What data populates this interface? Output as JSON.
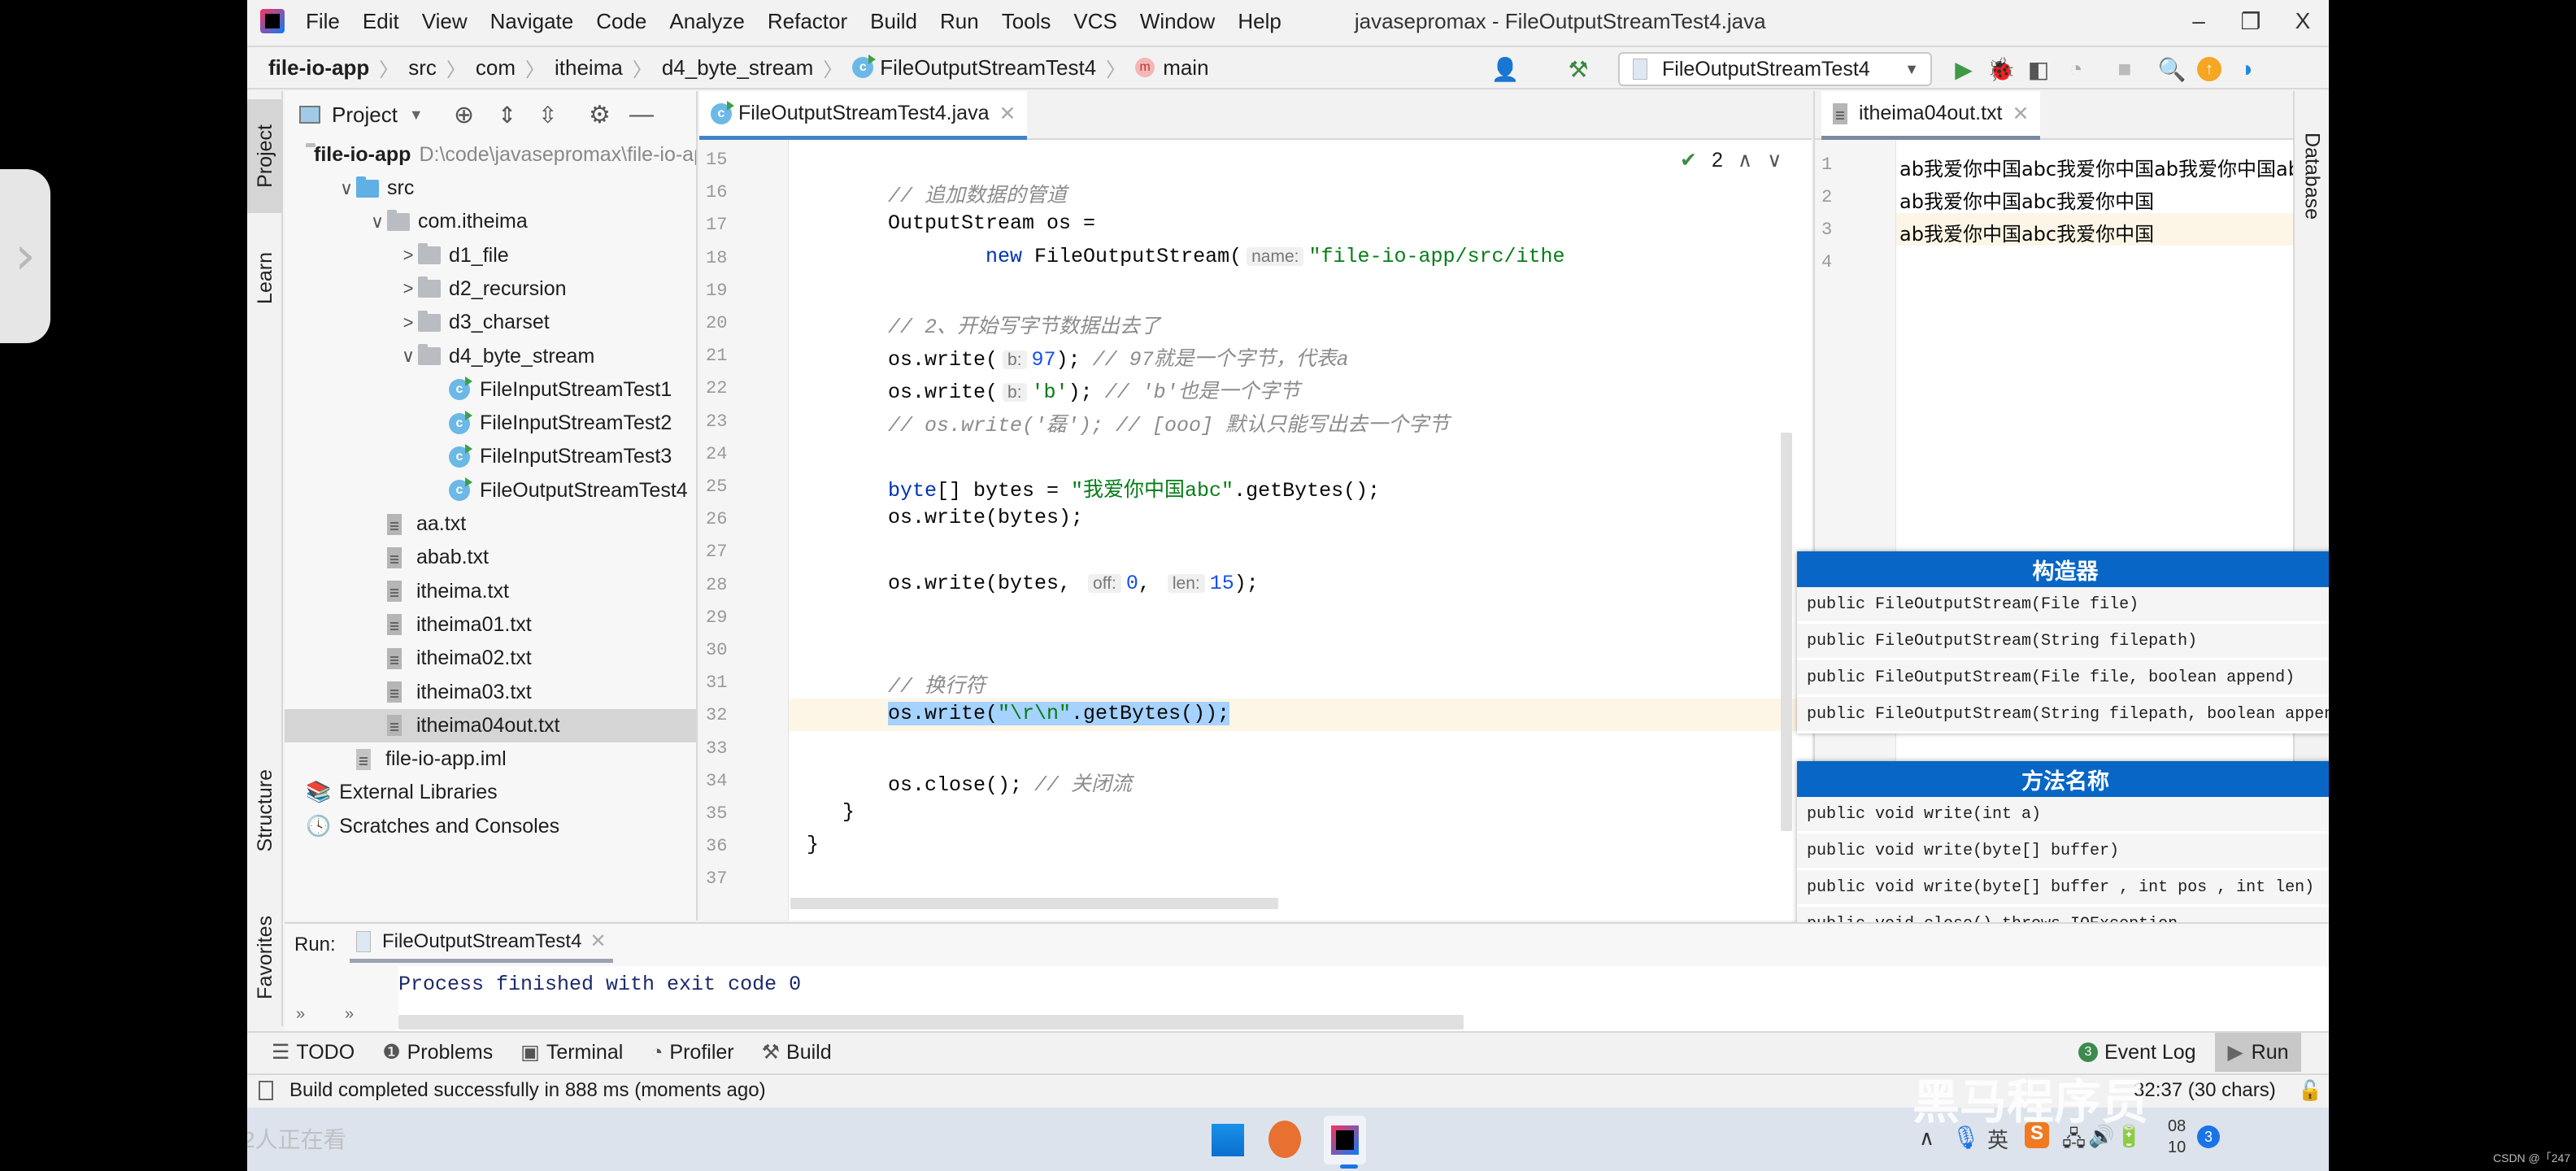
{
  "menu": {
    "items": [
      "File",
      "Edit",
      "View",
      "Navigate",
      "Code",
      "Analyze",
      "Refactor",
      "Build",
      "Run",
      "Tools",
      "VCS",
      "Window",
      "Help"
    ],
    "window_title": "javasepromax - FileOutputStreamTest4.java"
  },
  "window_controls": {
    "minimize": "–",
    "maximize": "❐",
    "close": "X"
  },
  "breadcrumb": [
    "file-io-app",
    "src",
    "com",
    "itheima",
    "d4_byte_stream",
    "FileOutputStreamTest4",
    "main"
  ],
  "toolbar": {
    "run_config": "FileOutputStreamTest4"
  },
  "left_stripe": {
    "project": "Project",
    "learn": "Learn",
    "structure": "Structure",
    "favorites": "Favorites"
  },
  "right_stripe": {
    "database": "Database"
  },
  "project": {
    "header": "Project",
    "root_name": "file-io-app",
    "root_path": "D:\\code\\javasepromax\\file-io-app",
    "tree": [
      {
        "label": "src",
        "type": "folder-blue",
        "depth": 1,
        "chevron": "∨"
      },
      {
        "label": "com.itheima",
        "type": "package",
        "depth": 2,
        "chevron": "∨"
      },
      {
        "label": "d1_file",
        "type": "package",
        "depth": 3,
        "chevron": ">"
      },
      {
        "label": "d2_recursion",
        "type": "package",
        "depth": 3,
        "chevron": ">"
      },
      {
        "label": "d3_charset",
        "type": "package",
        "depth": 3,
        "chevron": ">"
      },
      {
        "label": "d4_byte_stream",
        "type": "package",
        "depth": 3,
        "chevron": "∨"
      },
      {
        "label": "FileInputStreamTest1",
        "type": "class",
        "depth": 4
      },
      {
        "label": "FileInputStreamTest2",
        "type": "class",
        "depth": 4
      },
      {
        "label": "FileInputStreamTest3",
        "type": "class",
        "depth": 4
      },
      {
        "label": "FileOutputStreamTest4",
        "type": "class",
        "depth": 4
      },
      {
        "label": "aa.txt",
        "type": "txt",
        "depth": 2
      },
      {
        "label": "abab.txt",
        "type": "txt",
        "depth": 2
      },
      {
        "label": "itheima.txt",
        "type": "txt",
        "depth": 2
      },
      {
        "label": "itheima01.txt",
        "type": "txt",
        "depth": 2
      },
      {
        "label": "itheima02.txt",
        "type": "txt",
        "depth": 2
      },
      {
        "label": "itheima03.txt",
        "type": "txt",
        "depth": 2
      },
      {
        "label": "itheima04out.txt",
        "type": "txt",
        "depth": 2,
        "selected": true
      },
      {
        "label": "file-io-app.iml",
        "type": "iml",
        "depth": 1
      },
      {
        "label": "External Libraries",
        "type": "lib",
        "depth": 0
      },
      {
        "label": "Scratches and Consoles",
        "type": "scratch",
        "depth": 0
      }
    ]
  },
  "editor": {
    "tab": "FileOutputStreamTest4.java",
    "inspection_count": "2",
    "lines": [
      {
        "n": "15",
        "html": ""
      },
      {
        "n": "16",
        "html": "<span class='cm'>// 追加数据的管道</span>"
      },
      {
        "n": "17",
        "html": "OutputStream os ="
      },
      {
        "n": "18",
        "html": "        <span class='kw'>new</span> FileOutputStream(<span class='hint'>name:</span><span class='str'>\"file-io-app/src/ithe</span>"
      },
      {
        "n": "19",
        "html": ""
      },
      {
        "n": "20",
        "html": "<span class='cm'>// 2、开始写字节数据出去了</span>"
      },
      {
        "n": "21",
        "html": "os.write(<span class='hint'>b:</span><span class='num'>97</span>); <span class='cm'>// 97就是一个字节，代表a</span>"
      },
      {
        "n": "22",
        "html": "os.write(<span class='hint'>b:</span><span class='str'>'b'</span>); <span class='cm'>// 'b'也是一个字节</span>"
      },
      {
        "n": "23",
        "html": "<span class='cm'>// os.write('磊'); // [ooo] 默认只能写出去一个字节</span>"
      },
      {
        "n": "24",
        "html": ""
      },
      {
        "n": "25",
        "html": "<span class='kw'>byte</span>[] bytes = <span class='str'>\"我爱你中国abc\"</span>.getBytes();"
      },
      {
        "n": "26",
        "html": "os.write(bytes);"
      },
      {
        "n": "27",
        "html": ""
      },
      {
        "n": "28",
        "html": "os.write(bytes, <span class='hint'>off:</span><span class='num'>0</span>, <span class='hint'>len:</span><span class='num'>15</span>);"
      },
      {
        "n": "29",
        "html": ""
      },
      {
        "n": "30",
        "html": ""
      },
      {
        "n": "31",
        "html": "<span class='cm'>// 换行符</span>"
      },
      {
        "n": "32",
        "html": "<span class='sel'>os.write(<span class='str'>\"\\r\\n\"</span>.getBytes());</span>"
      },
      {
        "n": "33",
        "html": ""
      },
      {
        "n": "34",
        "html": "os.close(); <span class='cm'>// 关闭流</span>"
      },
      {
        "n": "35",
        "html": "}"
      },
      {
        "n": "36",
        "html": "}"
      },
      {
        "n": "37",
        "html": ""
      }
    ]
  },
  "txt_editor": {
    "tab": "itheima04out.txt",
    "lines": [
      {
        "n": "1",
        "text": "ab我爱你中国abc我爱你中国ab我爱你中国abc我爱你中国ab我爱你"
      },
      {
        "n": "2",
        "text": "ab我爱你中国abc我爱你中国"
      },
      {
        "n": "3",
        "text": "ab我爱你中国abc我爱你中国"
      },
      {
        "n": "4",
        "text": ""
      }
    ]
  },
  "constructors_card": {
    "title": "构造器",
    "rows": [
      "public FileOutputStream(File file)",
      "public FileOutputStream(String filepath)",
      "public FileOutputStream(File file, boolean append)",
      "public FileOutputStream(String filepath, boolean append)"
    ]
  },
  "methods_card": {
    "title": "方法名称",
    "rows": [
      "public void write(int a)",
      "public void write(byte[] buffer)",
      "public void write(byte[] buffer , int pos , int len)",
      "public void close() throws IOException"
    ]
  },
  "ime_bar": {
    "lang": "英",
    "items": [
      "moon",
      "punct",
      "keyboard",
      "settings"
    ]
  },
  "run_panel": {
    "label": "Run:",
    "tab": "FileOutputStreamTest4",
    "output": "Process finished with exit code 0"
  },
  "tool_strip": {
    "items": [
      "TODO",
      "Problems",
      "Terminal",
      "Profiler",
      "Build"
    ],
    "event_log": "Event Log",
    "event_log_badge": "3",
    "run": "Run"
  },
  "status_bar": {
    "message": "Build completed successfully in 888 ms (moments ago)",
    "position": "32:37 (30 chars)"
  },
  "taskbar": {
    "viewers": "2人正在看",
    "tray_lang": "英",
    "clock_line1": "08",
    "clock_line2": "10",
    "notif_count": "3",
    "watermark": "黑马程序员"
  },
  "corner_credit": "CSDN @「247"
}
